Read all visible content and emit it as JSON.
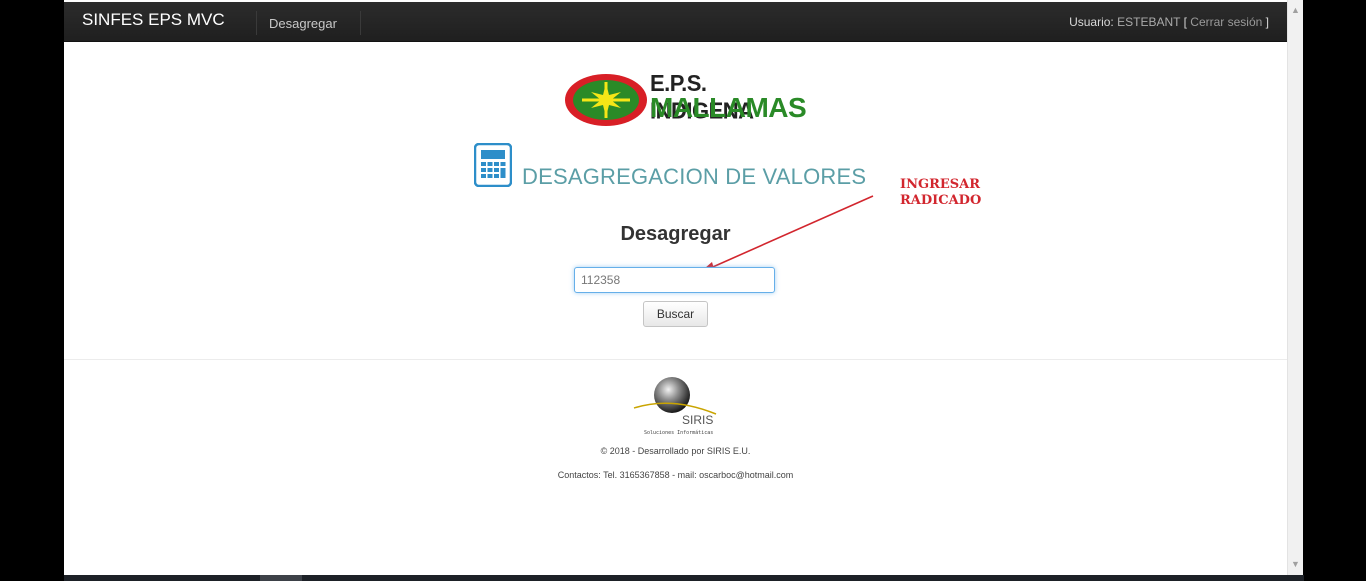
{
  "navbar": {
    "brand": "SINFES EPS MVC",
    "menu_item": "Desagregar",
    "user_label": "Usuario:",
    "user_name": "ESTEBANT",
    "logout_open": "[",
    "logout_label": "Cerrar sesión",
    "logout_close": "]"
  },
  "logo": {
    "line1": "E.P.S. INDIGENA",
    "line2": "MALLAMAS",
    "colors": {
      "oval_outer": "#d81f26",
      "oval_inner": "#2a8a27",
      "star": "#f5e617"
    }
  },
  "page": {
    "title": "DESAGREGACION DE VALORES",
    "title_icon": "calculator-icon",
    "annotation_line1": "INGRESAR",
    "annotation_line2": "RADICADO",
    "form_heading": "Desagregar",
    "input_value": "112358",
    "button_label": "Buscar"
  },
  "footer": {
    "logo_text": "SIRIS",
    "logo_subtext": "Soluciones  Informáticas",
    "copyright": "© 2018 - Desarrollado por SIRIS E.U.",
    "contacts": "Contactos: Tel. 3165367858 - mail: oscarboc@hotmail.com"
  },
  "colors": {
    "accent": "#5b9ea6",
    "annotation": "#d2262e",
    "navbar": "#222222"
  }
}
